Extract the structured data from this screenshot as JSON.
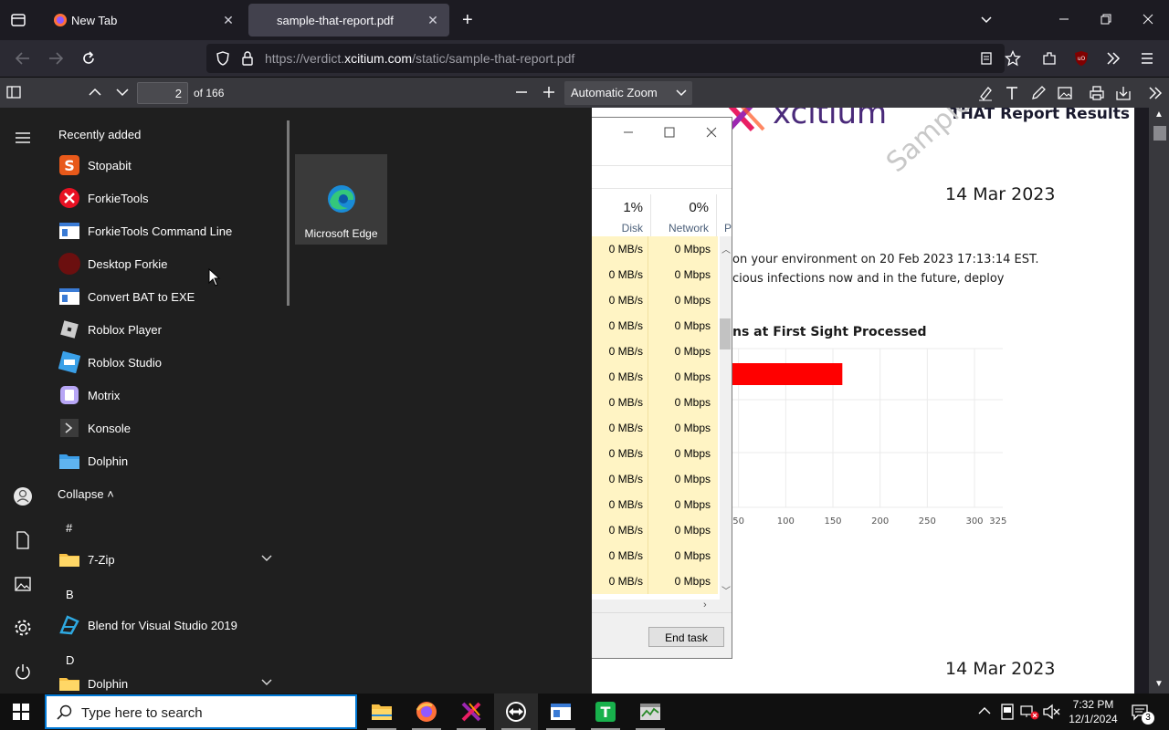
{
  "browser": {
    "tabs": [
      {
        "label": "New Tab"
      },
      {
        "label": "sample-that-report.pdf"
      }
    ],
    "url": {
      "prefix": "https://verdict.",
      "domain": "xcitium.com",
      "path": "/static/sample-that-report.pdf"
    }
  },
  "pdf_toolbar": {
    "page_value": "2",
    "page_count": "of 166",
    "zoom": "Automatic Zoom"
  },
  "pdf": {
    "brand": "xcitium",
    "header_right": "THAT Report Results",
    "watermark": "Sample Th",
    "date1": "14 Mar 2023",
    "line1": "on your environment on 20 Feb 2023 17:13:14 EST.",
    "line2": "cious infections now and in the future, deploy",
    "chart_title": "ns at First Sight Processed",
    "date2": "14 Mar 2023"
  },
  "chart_data": {
    "type": "bar",
    "title": "ns at First Sight Processed",
    "orientation": "horizontal",
    "xticks": [
      "50",
      "100",
      "150",
      "200",
      "250",
      "300",
      "325"
    ],
    "xlim": [
      25,
      325
    ],
    "values": [
      160
    ],
    "color": "#ff0000"
  },
  "taskmgr": {
    "disk_pct": "1%",
    "disk_label": "Disk",
    "net_pct": "0%",
    "net_label": "Network",
    "p_label": "P",
    "rows": [
      {
        "disk": "0 MB/s",
        "net": "0 Mbps"
      },
      {
        "disk": "0 MB/s",
        "net": "0 Mbps"
      },
      {
        "disk": "0 MB/s",
        "net": "0 Mbps"
      },
      {
        "disk": "0 MB/s",
        "net": "0 Mbps"
      },
      {
        "disk": "0 MB/s",
        "net": "0 Mbps"
      },
      {
        "disk": "0 MB/s",
        "net": "0 Mbps"
      },
      {
        "disk": "0 MB/s",
        "net": "0 Mbps"
      },
      {
        "disk": "0 MB/s",
        "net": "0 Mbps"
      },
      {
        "disk": "0 MB/s",
        "net": "0 Mbps"
      },
      {
        "disk": "0 MB/s",
        "net": "0 Mbps"
      },
      {
        "disk": "0 MB/s",
        "net": "0 Mbps"
      },
      {
        "disk": "0 MB/s",
        "net": "0 Mbps"
      },
      {
        "disk": "0 MB/s",
        "net": "0 Mbps"
      },
      {
        "disk": "0 MB/s",
        "net": "0 Mbps"
      }
    ],
    "end_task": "End task"
  },
  "start": {
    "recently_added": "Recently added",
    "recent": [
      {
        "label": "Stopabit",
        "icon": "stopabit-icon",
        "color": "#e8591a"
      },
      {
        "label": "ForkieTools",
        "icon": "error-x-icon",
        "color": "#e81123"
      },
      {
        "label": "ForkieTools Command Line",
        "icon": "window-app-icon",
        "color": "#3a7bd5"
      },
      {
        "label": "Desktop Forkie",
        "icon": "forkie-icon",
        "color": "#6b0f0f"
      },
      {
        "label": "Convert BAT to EXE",
        "icon": "window-app-icon",
        "color": "#3a7bd5"
      },
      {
        "label": "Roblox Player",
        "icon": "roblox-icon",
        "color": "#cccccc"
      },
      {
        "label": "Roblox Studio",
        "icon": "roblox-studio-icon",
        "color": "#3aa0e8"
      },
      {
        "label": "Motrix",
        "icon": "motrix-icon",
        "color": "#b7a6f5"
      },
      {
        "label": "Konsole",
        "icon": "konsole-icon",
        "color": "#3b3b3b"
      },
      {
        "label": "Dolphin",
        "icon": "folder-blue-icon",
        "color": "#3c9ee8"
      }
    ],
    "collapse": "Collapse",
    "sections": [
      {
        "letter": "#",
        "apps": [
          {
            "label": "7-Zip",
            "icon": "folder-icon"
          }
        ]
      },
      {
        "letter": "B",
        "apps": [
          {
            "label": "Blend for Visual Studio 2019",
            "icon": "blend-icon"
          }
        ]
      },
      {
        "letter": "D",
        "apps": [
          {
            "label": "Dolphin",
            "icon": "folder-icon"
          }
        ]
      }
    ],
    "pinned": [
      {
        "label": "Microsoft Edge",
        "icon": "edge-icon"
      }
    ]
  },
  "taskbar": {
    "search_placeholder": "Type here to search",
    "time": "7:32 PM",
    "date": "12/1/2024",
    "notif_count": "3"
  }
}
